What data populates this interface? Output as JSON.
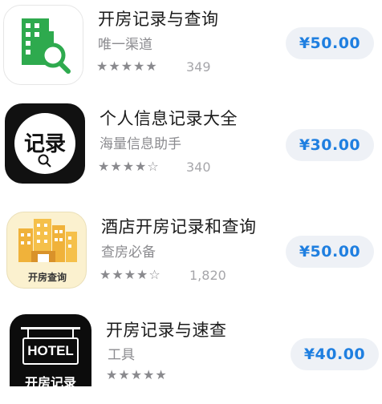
{
  "apps": [
    {
      "name": "开房记录与查询",
      "subtitle": "唯一渠道",
      "stars": "★★★★★",
      "rating": 4.5,
      "ratings_count": "349",
      "price": "¥50.00",
      "icon": "building-search-icon"
    },
    {
      "name": "个人信息记录大全",
      "subtitle": "海量信息助手",
      "stars": "★★★★☆",
      "rating": 4,
      "ratings_count": "340",
      "price": "¥30.00",
      "icon": "records-icon",
      "icon_text": "记录"
    },
    {
      "name": "酒店开房记录和查询",
      "subtitle": "查房必备",
      "stars": "★★★★☆",
      "rating": 4,
      "ratings_count": "1,820",
      "price": "¥50.00",
      "icon": "hotel-buildings-icon",
      "icon_text": "开房查询"
    },
    {
      "name": "开房记录与速查",
      "subtitle": "工具",
      "stars": "★★★★★",
      "price": "¥40.00",
      "icon": "hotel-sign-icon",
      "icon_text": "HOTEL",
      "icon_caption": "开房记录"
    }
  ],
  "colors": {
    "price_text": "#1f7fe0",
    "price_bg": "#eef1f6",
    "icon1_green": "#2eaa4e",
    "icon3_bg": "#fbf1cf",
    "icon3_building": "#f0b23a"
  }
}
